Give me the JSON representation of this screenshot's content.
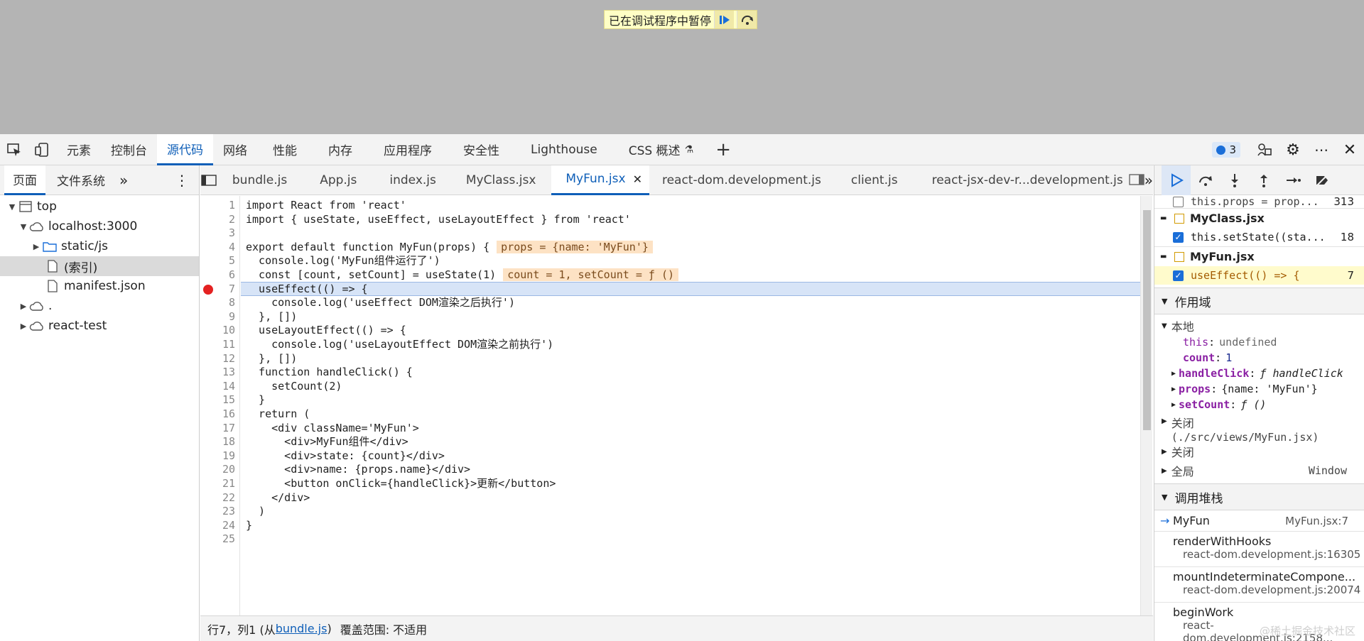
{
  "banner": {
    "text": "已在调试程序中暂停"
  },
  "top_tabs": [
    "元素",
    "控制台",
    "源代码",
    "网络",
    "性能",
    "内存",
    "应用程序",
    "安全性",
    "Lighthouse",
    "CSS 概述"
  ],
  "issues_count": "3",
  "sub_tabs": [
    "页面",
    "文件系统"
  ],
  "tree": [
    {
      "label": "top",
      "depth": 0,
      "icon": "frame"
    },
    {
      "label": "localhost:3000",
      "depth": 1,
      "icon": "cloud"
    },
    {
      "label": "static/js",
      "depth": 2,
      "icon": "folder"
    },
    {
      "label": "(索引)",
      "depth": 3,
      "icon": "file",
      "selected": true
    },
    {
      "label": "manifest.json",
      "depth": 3,
      "icon": "file"
    },
    {
      "label": ".",
      "depth": 1,
      "icon": "cloud"
    },
    {
      "label": "react-test",
      "depth": 1,
      "icon": "cloud"
    }
  ],
  "file_tabs": [
    "bundle.js",
    "App.js",
    "index.js",
    "MyClass.jsx",
    "MyFun.jsx",
    "react-dom.development.js",
    "client.js",
    "react-jsx-dev-r...development.js"
  ],
  "active_file": "MyFun.jsx",
  "code_lines": [
    "import React from 'react'",
    "import { useState, useEffect, useLayoutEffect } from 'react'",
    "",
    "export default function MyFun(props) {",
    "  console.log('MyFun组件运行了')",
    "  const [count, setCount] = useState(1)",
    "  useEffect(() => {",
    "    console.log('useEffect DOM渲染之后执行')",
    "  }, [])",
    "  useLayoutEffect(() => {",
    "    console.log('useLayoutEffect DOM渲染之前执行')",
    "  }, [])",
    "  function handleClick() {",
    "    setCount(2)",
    "  }",
    "  return (",
    "    <div className='MyFun'>",
    "      <div>MyFun组件</div>",
    "      <div>state: {count}</div>",
    "      <div>name: {props.name}</div>",
    "      <button onClick={handleClick}>更新</button>",
    "    </div>",
    "  )",
    "}",
    ""
  ],
  "inline_values": {
    "line4": "props = {name: 'MyFun'}",
    "line6": "count = 1, setCount = ƒ ()"
  },
  "breakpoint_line": 7,
  "status": {
    "position": "行7，列1 (从",
    "source_link": "bundle.js",
    "position_end": ")",
    "coverage": "覆盖范围: 不适用"
  },
  "breakpoints": {
    "top_item": {
      "code": "this.props = prop...",
      "line": "313"
    },
    "files": [
      {
        "file": "MyClass.jsx",
        "code": "this.setState((sta...",
        "line": "18"
      },
      {
        "file": "MyFun.jsx",
        "code": "useEffect(() => {",
        "line": "7"
      }
    ]
  },
  "scope": {
    "title": "作用域",
    "local_label": "本地",
    "vars": [
      {
        "name": "this",
        "value": "undefined"
      },
      {
        "name": "count",
        "value": "1"
      },
      {
        "name": "handleClick",
        "value": "ƒ handleClick"
      },
      {
        "name": "props",
        "value": "{name: 'MyFun'}"
      },
      {
        "name": "setCount",
        "value": "ƒ ()"
      }
    ],
    "closure_label": "关闭",
    "closure_path": "(./src/views/MyFun.jsx)",
    "closure2_label": "关闭",
    "global_label": "全局",
    "global_value": "Window"
  },
  "callstack": {
    "title": "调用堆栈",
    "frames": [
      {
        "name": "MyFun",
        "loc": "MyFun.jsx:7"
      },
      {
        "name": "renderWithHooks",
        "loc": "react-dom.development.js:16305"
      },
      {
        "name": "mountIndeterminateCompone...",
        "loc": "react-dom.development.js:20074"
      },
      {
        "name": "beginWork",
        "loc": "react-dom.development.js:2158..."
      }
    ]
  },
  "watermark": "@稀土掘金技术社区"
}
